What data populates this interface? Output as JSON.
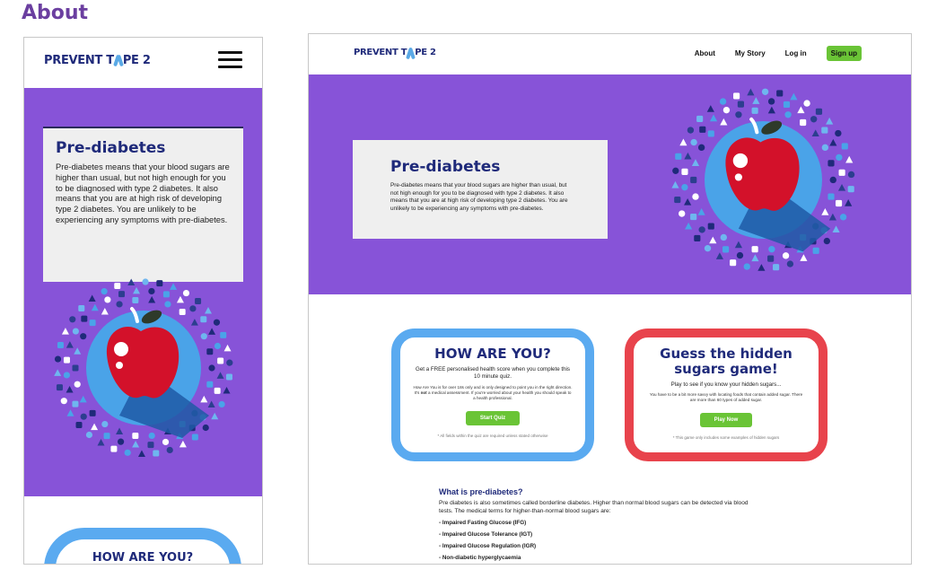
{
  "page": {
    "heading": "About"
  },
  "brand": {
    "logo_part1": "PREVENT T",
    "logo_part2": "PE 2"
  },
  "nav": {
    "about": "About",
    "story": "My Story",
    "login": "Log in",
    "signup": "Sign up"
  },
  "hero": {
    "title": "Pre-diabetes",
    "body": "Pre-diabetes means that your blood sugars are higher than usual, but not high enough for you to be diagnosed with type 2 diabetes. It also means that you are at high risk of developing type 2 diabetes. You are unlikely to be experiencing any symptoms with pre-diabetes."
  },
  "quiz": {
    "title": "HOW ARE YOU?",
    "lead": "Get a FREE personalised health score when you complete this 10 minute quiz.",
    "small_before": "How Are You is for over 18s only and is only designed to point you in the right direction. It's ",
    "small_bold": "not",
    "small_after": " a medical assessment. If you're worried about your health you should speak to a health professional.",
    "button": "Start Quiz",
    "footnote": "* All fields within the quiz are required unless stated otherwise"
  },
  "game": {
    "title": "Guess the hidden sugars game!",
    "lead": "Play to see if you know your hidden sugars...",
    "small": "You have to be a bit more savvy with locating foods that contain added sugar. There are more than 60 types of added sugar.",
    "button": "Play Now",
    "footnote": "* This game only includes some examples of hidden sugars"
  },
  "info": {
    "heading": "What is pre-diabetes?",
    "body": "Pre diabetes is also sometimes called borderline diabetes. Higher than normal blood sugars can be detected via blood tests. The medical terms for higher-than-normal blood sugars are:",
    "items": [
      "- Impaired Fasting Glucose (IFG)",
      "- Impaired Glucose Tolerance (IGT)",
      "- Impaired Glucose Regulation (IGR)",
      "- Non-diabetic hyperglycaemia"
    ]
  },
  "colors": {
    "purple": "#8753d8",
    "navy": "#1f2a7a",
    "blue": "#5aaaf0",
    "red": "#e8434c",
    "green": "#6ac436"
  },
  "icons": [
    "menu-icon",
    "ribbon-icon",
    "apple-icon",
    "health-icon-wreath"
  ]
}
